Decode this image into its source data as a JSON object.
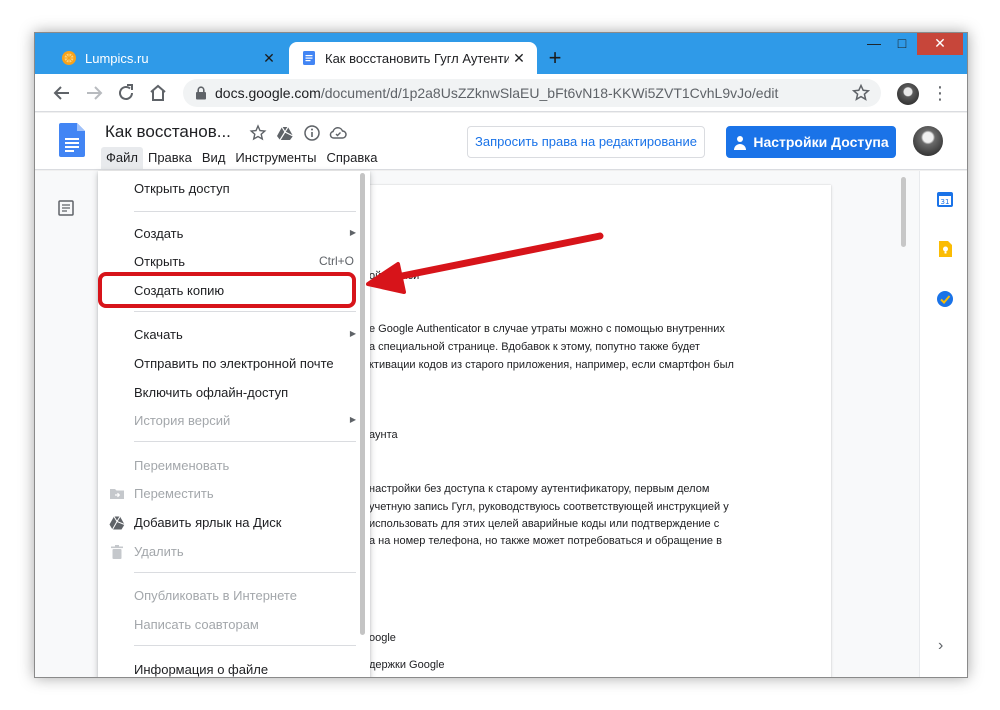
{
  "browser": {
    "tabs": [
      {
        "title": "Lumpics.ru",
        "active": false
      },
      {
        "title": "Как восстановить Гугл Аутентиф",
        "active": true
      }
    ],
    "new_tab": "+",
    "url_host": "docs.google.com",
    "url_path": "/document/d/1p2a8UsZZknwSlaEU_bFt6vN18-KKWi5ZVT1CvhL9vJo/edit",
    "window_controls": {
      "minimize": "—",
      "maximize": "□",
      "close": "✕"
    },
    "menu_glyph": "⋮"
  },
  "docs": {
    "title": "Как восстанов...",
    "menubar": [
      "Файл",
      "Правка",
      "Вид",
      "Инструменты",
      "Справка"
    ],
    "request_edit": "Запросить права на редактирование",
    "share": "Настройки Доступа"
  },
  "document_lines": [
    "ой записи",
    "e Google Authenticator в случае утраты можно с помощью внутренних",
    "а специальной странице. Вдобавок к этому, попутно также будет",
    "ктивации кодов из старого приложения, например, если смартфон был",
    "аунта",
    "настройки без доступа к старому аутентификатору, первым делом",
    "учетную запись Гугл, руководствуюсь соответствующей инструкцией у",
    "использовать для этих целей аварийные коды или подтверждение с",
    "а на номер телефона, но также может потребоваться и обращение в",
    "oogle",
    "держки Google"
  ],
  "file_menu": {
    "items": [
      {
        "label": "Открыть доступ",
        "enabled": true
      },
      {
        "label": "Создать",
        "enabled": true,
        "submenu": true
      },
      {
        "label": "Открыть",
        "enabled": true,
        "shortcut": "Ctrl+O"
      },
      {
        "label": "Создать копию",
        "enabled": true,
        "highlighted": true
      },
      {
        "label": "Скачать",
        "enabled": true,
        "submenu": true
      },
      {
        "label": "Отправить по электронной почте",
        "enabled": true
      },
      {
        "label": "Включить офлайн-доступ",
        "enabled": true
      },
      {
        "label": "История версий",
        "enabled": false,
        "submenu": true
      },
      {
        "label": "Переименовать",
        "enabled": false
      },
      {
        "label": "Переместить",
        "enabled": false,
        "icon": "folder-move-icon"
      },
      {
        "label": "Добавить ярлык на Диск",
        "enabled": true,
        "icon": "drive-shortcut-icon"
      },
      {
        "label": "Удалить",
        "enabled": false,
        "icon": "trash-icon"
      },
      {
        "label": "Опубликовать в Интернете",
        "enabled": false
      },
      {
        "label": "Написать соавторам",
        "enabled": false
      },
      {
        "label": "Информация о файле",
        "enabled": true
      }
    ]
  },
  "colors": {
    "tabstrip": "#2f9ae8",
    "accent": "#1a73e8",
    "annotation": "#d7141a"
  }
}
